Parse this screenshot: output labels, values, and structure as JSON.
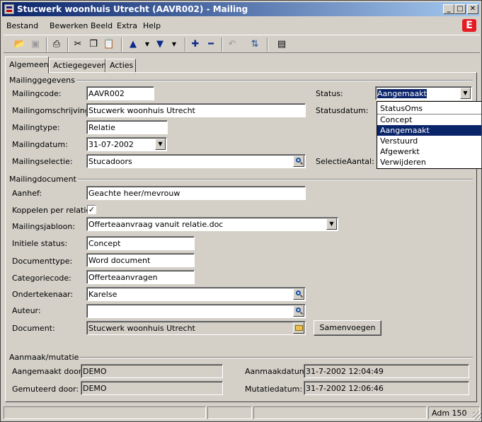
{
  "window": {
    "title": "Stucwerk woonhuis Utrecht (AAVR002) - Mailing",
    "minimize": "_",
    "maximize": "□",
    "close": "✕"
  },
  "menu": [
    "Bestand",
    "Bewerken",
    "Beeld",
    "Extra",
    "Help"
  ],
  "brand_letter": "E",
  "toolbar_icons": [
    "open-folder-icon",
    "save-icon",
    "print-icon",
    "cut-icon",
    "copy-icon",
    "paste-icon",
    "up-arrow-icon",
    "down-arrow-icon",
    "plus-icon",
    "minus-icon",
    "undo-icon",
    "refresh-icon",
    "layout-icon"
  ],
  "tabs": [
    "Algemeen",
    "Actiegegevens",
    "Acties"
  ],
  "section1": {
    "title": "Mailinggegevens",
    "mailingcode_label": "Mailingcode:",
    "mailingcode": "AAVR002",
    "omschrijving_label": "Mailingomschrijving:",
    "omschrijving": "Stucwerk woonhuis Utrecht",
    "type_label": "Mailingtype:",
    "type": "Relatie",
    "datum_label": "Mailingdatum:",
    "datum": "31-07-2002",
    "selectie_label": "Mailingselectie:",
    "selectie": "Stucadoors",
    "status_label": "Status:",
    "status": "Aangemaakt",
    "statusdatum_label": "Statusdatum:",
    "selectieaantal_label": "SelectieAantal:"
  },
  "status_dropdown": {
    "header": "StatusOms",
    "options": [
      "Concept",
      "Aangemaakt",
      "Verstuurd",
      "Afgewerkt",
      "Verwijderen"
    ],
    "selected": "Aangemaakt"
  },
  "section2": {
    "title": "Mailingdocument",
    "aanhef_label": "Aanhef:",
    "aanhef": "Geachte heer/mevrouw",
    "koppelen_label": "Koppelen per relatie",
    "koppelen_checked": "✓",
    "jabloon_label": "Mailingsjabloon:",
    "jabloon": "Offerteaanvraag vanuit relatie.doc",
    "initiele_label": "Initiele status:",
    "initiele": "Concept",
    "doctype_label": "Documenttype:",
    "doctype": "Word document",
    "categorie_label": "Categoriecode:",
    "categorie": "Offerteaanvragen",
    "ondertekenaar_label": "Ondertekenaar:",
    "ondertekenaar": "Karelse",
    "auteur_label": "Auteur:",
    "auteur": "",
    "document_label": "Document:",
    "document": "Stucwerk woonhuis Utrecht",
    "samenvoegen": "Samenvoegen"
  },
  "section3": {
    "title": "Aanmaak/mutatie",
    "aangemaakt_door_label": "Aangemaakt door:",
    "aangemaakt_door": "DEMO",
    "gemuteerd_door_label": "Gemuteerd door:",
    "gemuteerd_door": "DEMO",
    "aanmaakdatum_label": "Aanmaakdatum:",
    "aanmaakdatum": "31-7-2002 12:04:49",
    "mutatiedatum_label": "Mutatiedatum:",
    "mutatiedatum": "31-7-2002 12:06:46"
  },
  "statusbar": {
    "user": "Adm 150"
  }
}
